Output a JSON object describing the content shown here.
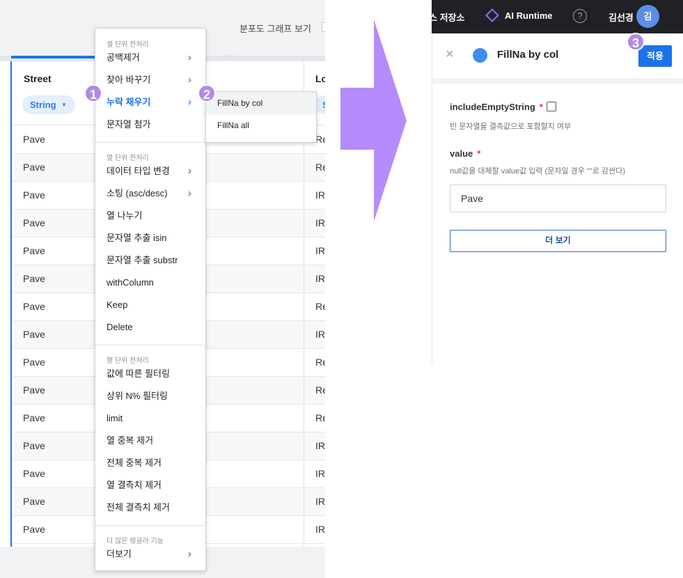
{
  "left": {
    "toolbar": {
      "scatter_label": "분포도 그래프 보기"
    },
    "table": {
      "column_name": "Street",
      "column_type": "String",
      "column2_name": "Lo",
      "column2_type": "S",
      "rows": [
        {
          "street": "Pave",
          "next": "Re"
        },
        {
          "street": "Pave",
          "next": "Re"
        },
        {
          "street": "Pave",
          "next": "IR"
        },
        {
          "street": "Pave",
          "next": "IR"
        },
        {
          "street": "Pave",
          "next": "IR"
        },
        {
          "street": "Pave",
          "next": "IR"
        },
        {
          "street": "Pave",
          "next": "Re"
        },
        {
          "street": "Pave",
          "next": "IR"
        },
        {
          "street": "Pave",
          "next": "Re"
        },
        {
          "street": "Pave",
          "next": "Re"
        },
        {
          "street": "Pave",
          "next": "Re"
        },
        {
          "street": "Pave",
          "next": "IR"
        },
        {
          "street": "Pave",
          "next": "IR"
        },
        {
          "street": "Pave",
          "next": "IR"
        },
        {
          "street": "Pave",
          "next": "IR"
        }
      ]
    },
    "menu": {
      "cell_section": "셀 단위 전처리",
      "col_section": "열 단위 전처리",
      "row_section": "행 단위 전처리",
      "more_section": "더 많은 랭글러 기능",
      "items": {
        "trim": "공백제거",
        "find_replace": "찾아 바꾸기",
        "fill_missing": "누락 채우기",
        "append_string": "문자열 첨가",
        "change_type": "데이터 타입 변경",
        "sort": "소팅 (asc/desc)",
        "split": "열 나누기",
        "extract_isin": "문자열 추출 isin",
        "extract_substr": "문자열 추출 substr",
        "with_column": "withColumn",
        "keep": "Keep",
        "delete": "Delete",
        "filter_value": "값에 따른 필터링",
        "filter_top": "상위 N% 필터링",
        "limit": "limit",
        "dedup_col": "열 중복 제거",
        "dedup_all": "전체 중복 제거",
        "dropna_col": "열 결측치 제거",
        "dropna_all": "전체 결측치 제거",
        "more": "더보기"
      },
      "chevron": "›"
    },
    "submenu": {
      "fillna_col": "FillNa by col",
      "fillna_all": "FillNa all"
    }
  },
  "badges": {
    "b1": "1",
    "b2": "2",
    "b3": "3"
  },
  "right": {
    "nav": {
      "storage": "스 저장소",
      "runtime": "AI Runtime",
      "help": "?",
      "user_name": "김선경",
      "avatar": "김"
    },
    "dialog": {
      "title": "FillNa by col",
      "apply": "적용",
      "close": "×",
      "param1_label": "includeEmptyString",
      "param1_desc": "빈 문자열을 결측값으로 포함할지 여부",
      "param2_label": "value",
      "param2_desc": "null값을 대체할 value값 입력 (문자일 경우 \"\"로 감싼다)",
      "value_input": "Pave",
      "more_button": "더 보기",
      "required": "*"
    }
  },
  "colors": {
    "accent": "#1a73e8",
    "badge": "#b08ae8",
    "arrow": "#b58cfb",
    "nav_bg": "#202124"
  }
}
